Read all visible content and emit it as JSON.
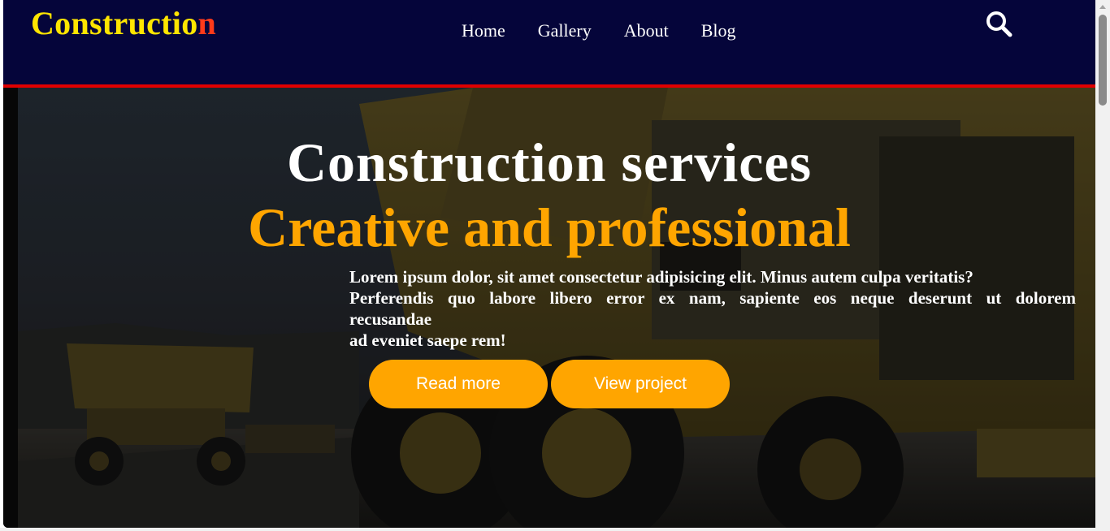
{
  "brand": {
    "name_main": "Constructio",
    "name_last_letter": "n"
  },
  "nav": {
    "items": [
      {
        "label": "Home"
      },
      {
        "label": "Gallery"
      },
      {
        "label": "About"
      },
      {
        "label": "Blog"
      }
    ],
    "search_icon": "search-icon"
  },
  "hero": {
    "title": "Construction services",
    "subtitle": "Creative and professional",
    "paragraph": {
      "line1": "Lorem ipsum dolor, sit amet consectetur adipisicing elit. Minus autem culpa veritatis?",
      "line2": "Perferendis quo labore libero error ex nam, sapiente eos neque deserunt ut dolorem",
      "line3": "recusandae",
      "line4": "ad eveniet saepe rem!"
    },
    "buttons": {
      "read_more": "Read more",
      "view_project": "View project"
    },
    "background": "construction-trucks-photo"
  },
  "colors": {
    "navbar_bg": "#05053a",
    "accent_line": "#e00000",
    "brand_yellow": "#ffe500",
    "brand_red": "#ff3a1a",
    "orange": "#ffa500"
  }
}
